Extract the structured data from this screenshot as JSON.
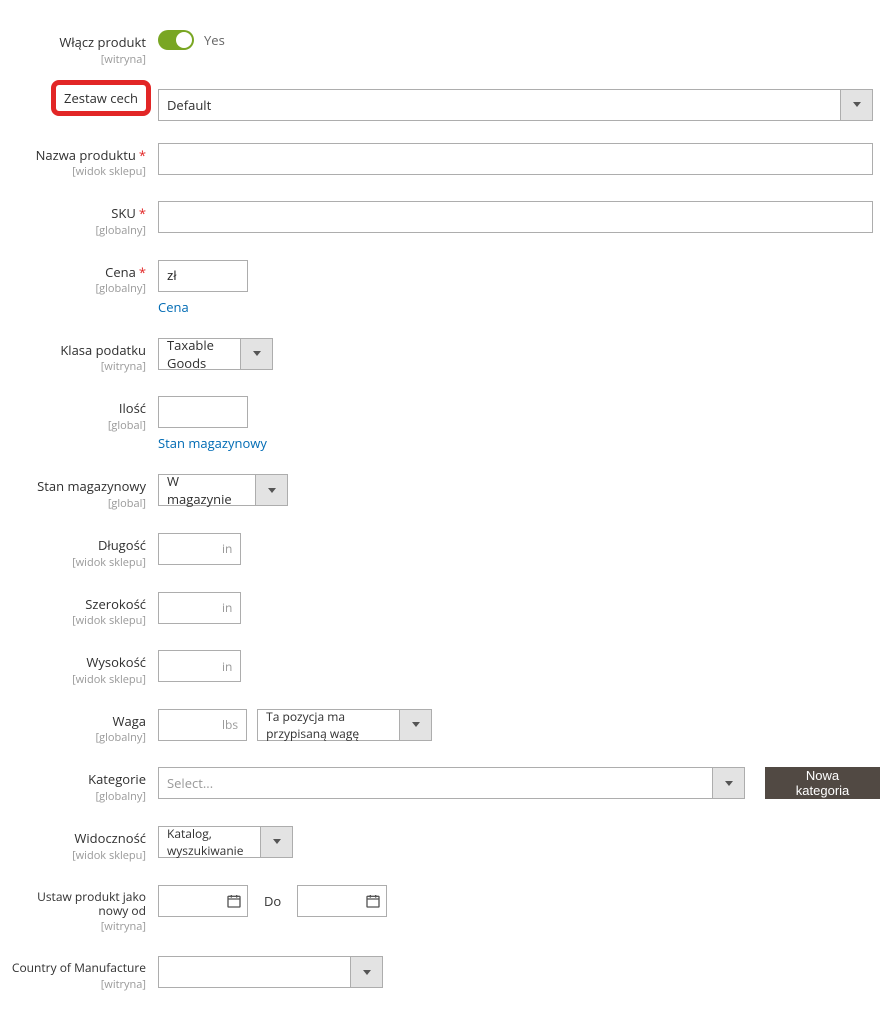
{
  "fields": {
    "enable": {
      "label": "Włącz produkt",
      "scope": "[witryna]",
      "value": "Yes"
    },
    "attrset": {
      "label": "Zestaw cech",
      "value": "Default"
    },
    "name": {
      "label": "Nazwa produktu",
      "scope": "[widok sklepu]",
      "value": ""
    },
    "sku": {
      "label": "SKU",
      "scope": "[globalny]",
      "value": ""
    },
    "price": {
      "label": "Cena",
      "scope": "[globalny]",
      "value": "zł",
      "link": "Cena"
    },
    "taxclass": {
      "label": "Klasa podatku",
      "scope": "[witryna]",
      "value": "Taxable Goods"
    },
    "qty": {
      "label": "Ilość",
      "scope": "[global]",
      "value": "",
      "link": "Stan magazynowy"
    },
    "stock": {
      "label": "Stan magazynowy",
      "scope": "[global]",
      "value": "W magazynie"
    },
    "length": {
      "label": "Długość",
      "scope": "[widok sklepu]",
      "suffix": "in"
    },
    "width": {
      "label": "Szerokość",
      "scope": "[widok sklepu]",
      "suffix": "in"
    },
    "height": {
      "label": "Wysokość",
      "scope": "[widok sklepu]",
      "suffix": "in"
    },
    "weight": {
      "label": "Waga",
      "scope": "[globalny]",
      "suffix": "lbs",
      "mode": "Ta pozycja ma przypisaną wagę"
    },
    "categories": {
      "label": "Kategorie",
      "scope": "[globalny]",
      "placeholder": "Select...",
      "button": "Nowa kategoria"
    },
    "visibility": {
      "label": "Widoczność",
      "scope": "[widok sklepu]",
      "value": "Katalog, wyszukiwanie"
    },
    "newfrom": {
      "label": "Ustaw produkt jako nowy od",
      "scope": "[witryna]",
      "to": "Do"
    },
    "country": {
      "label": "Country of Manufacture",
      "scope": "[witryna]",
      "value": ""
    }
  }
}
